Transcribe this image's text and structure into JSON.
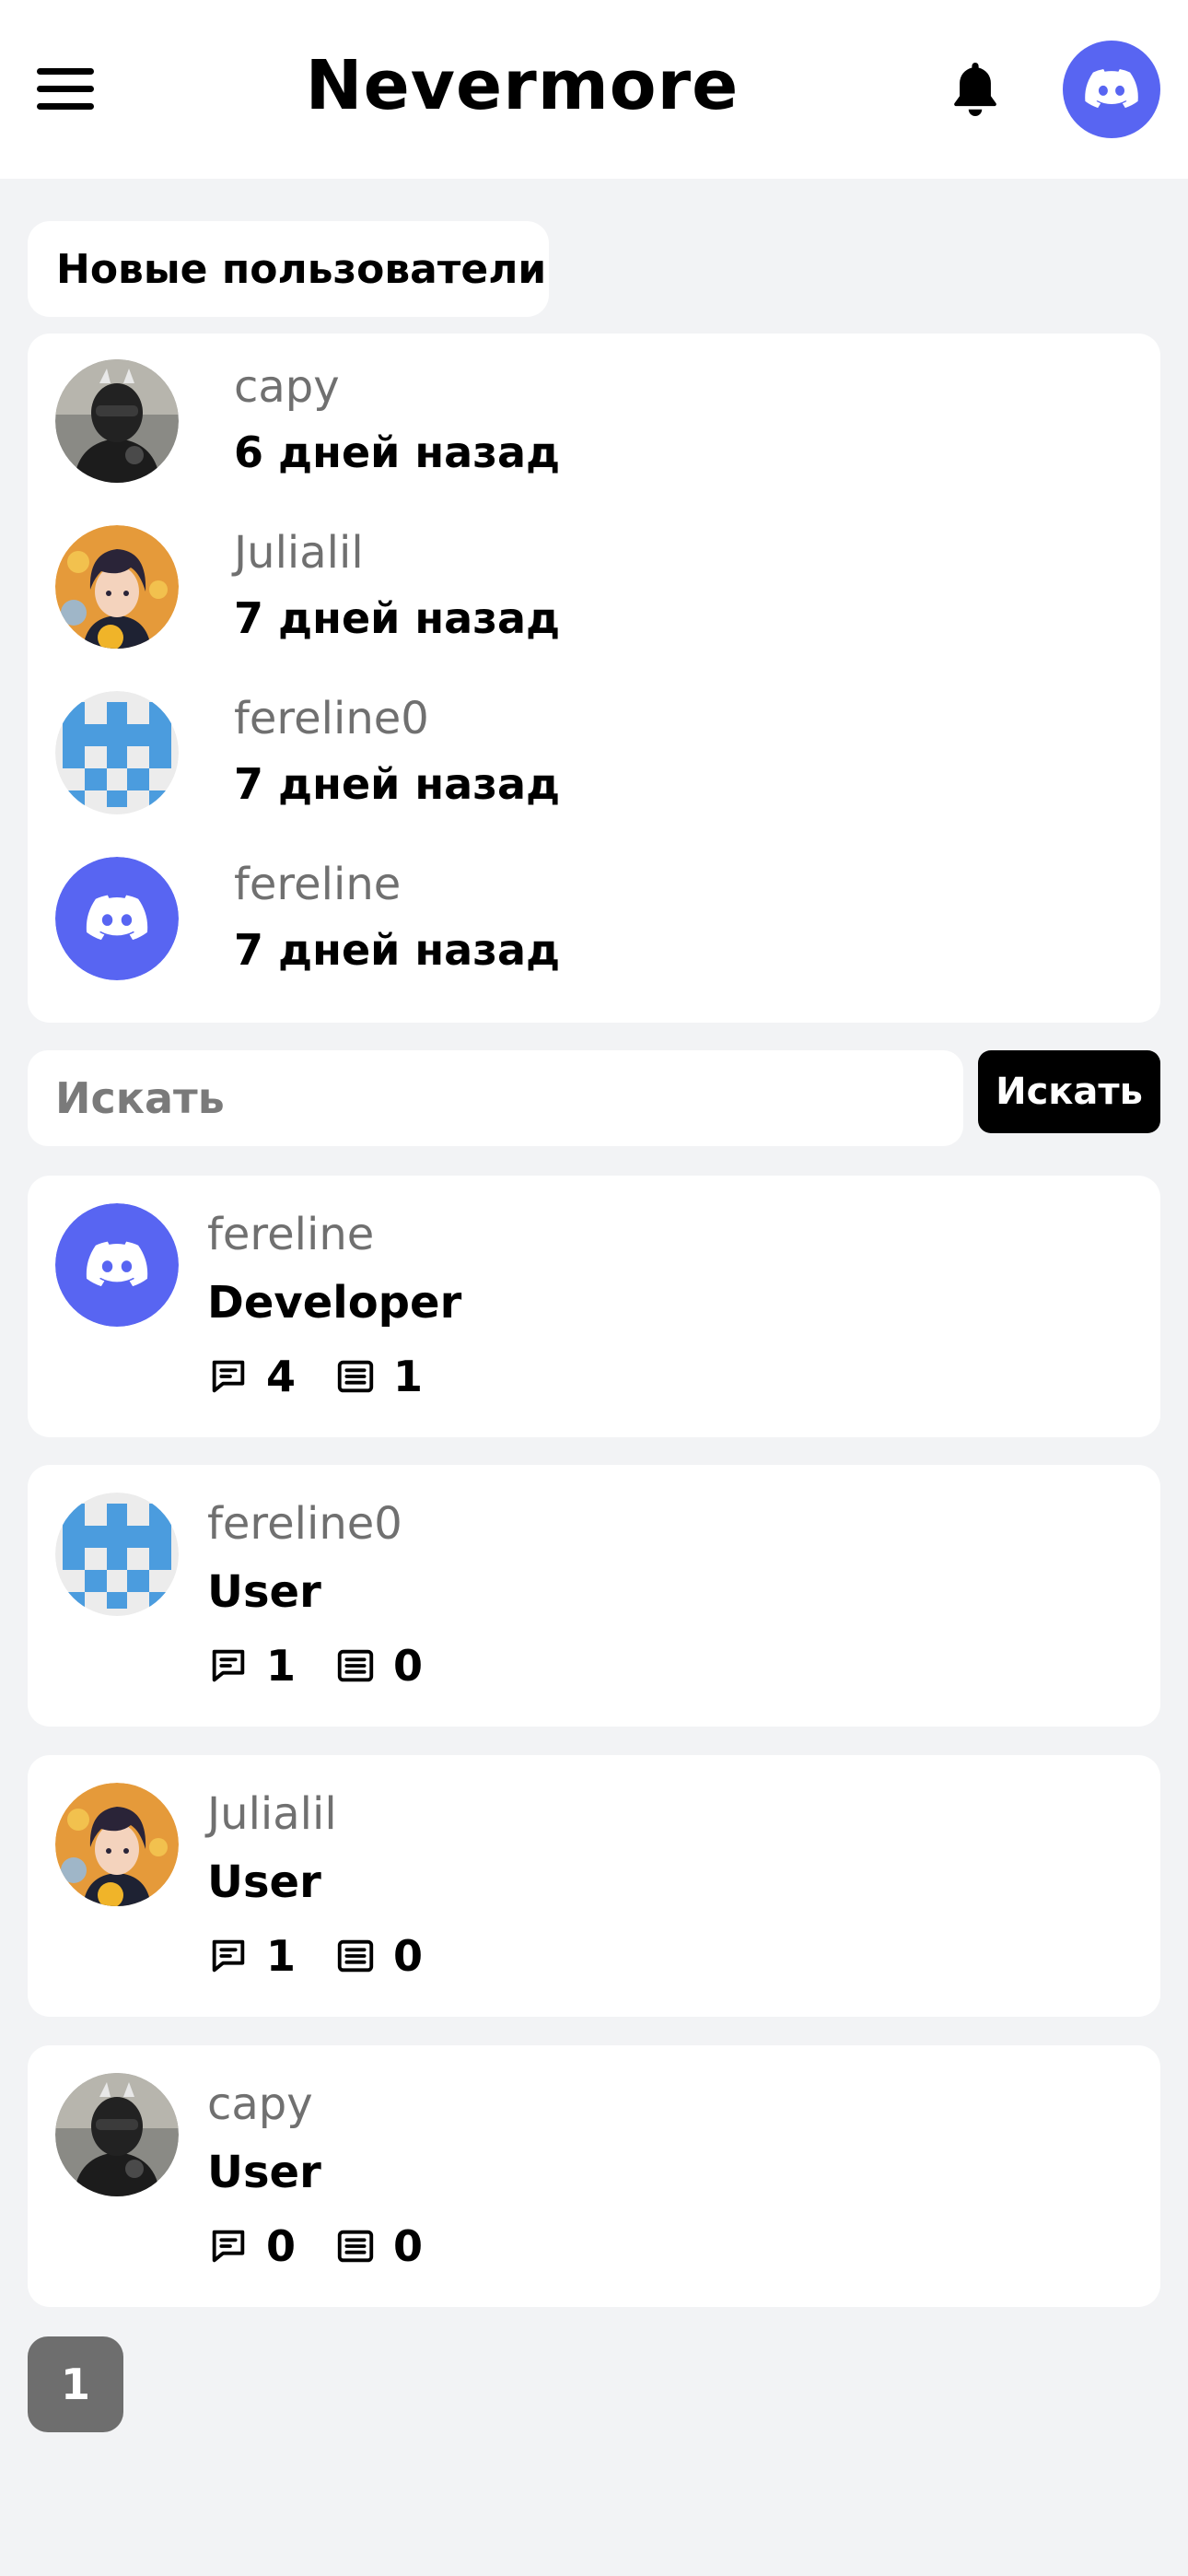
{
  "header": {
    "title": "Nevermore",
    "menu_icon": "hamburger-menu-icon",
    "notification_icon": "bell-icon",
    "profile_icon": "discord-avatar-icon"
  },
  "new_users": {
    "label": "Новые пользователи",
    "items": [
      {
        "name": "capy",
        "time": "6 дней назад",
        "avatar": "photo-masked-person"
      },
      {
        "name": "Julialil",
        "time": "7 дней назад",
        "avatar": "anime-portrait"
      },
      {
        "name": "fereline0",
        "time": "7 дней назад",
        "avatar": "blue-pixel-identicon"
      },
      {
        "name": "fereline",
        "time": "7 дней назад",
        "avatar": "discord-default"
      }
    ]
  },
  "search": {
    "placeholder": "Искать",
    "value": "",
    "button_label": "Искать"
  },
  "users": [
    {
      "name": "fereline",
      "role": "Developer",
      "comments": "4",
      "posts": "1",
      "avatar": "discord-default"
    },
    {
      "name": "fereline0",
      "role": "User",
      "comments": "1",
      "posts": "0",
      "avatar": "blue-pixel-identicon"
    },
    {
      "name": "Julialil",
      "role": "User",
      "comments": "1",
      "posts": "0",
      "avatar": "anime-portrait"
    },
    {
      "name": "capy",
      "role": "User",
      "comments": "0",
      "posts": "0",
      "avatar": "photo-masked-person"
    }
  ],
  "pagination": {
    "current": "1"
  },
  "colors": {
    "background": "#f2f3f5",
    "card": "#ffffff",
    "discord_blurple": "#5865f2",
    "identicon_blue": "#4b9cde",
    "muted_text": "#707070",
    "pagination_bg": "#6e6e6e"
  }
}
